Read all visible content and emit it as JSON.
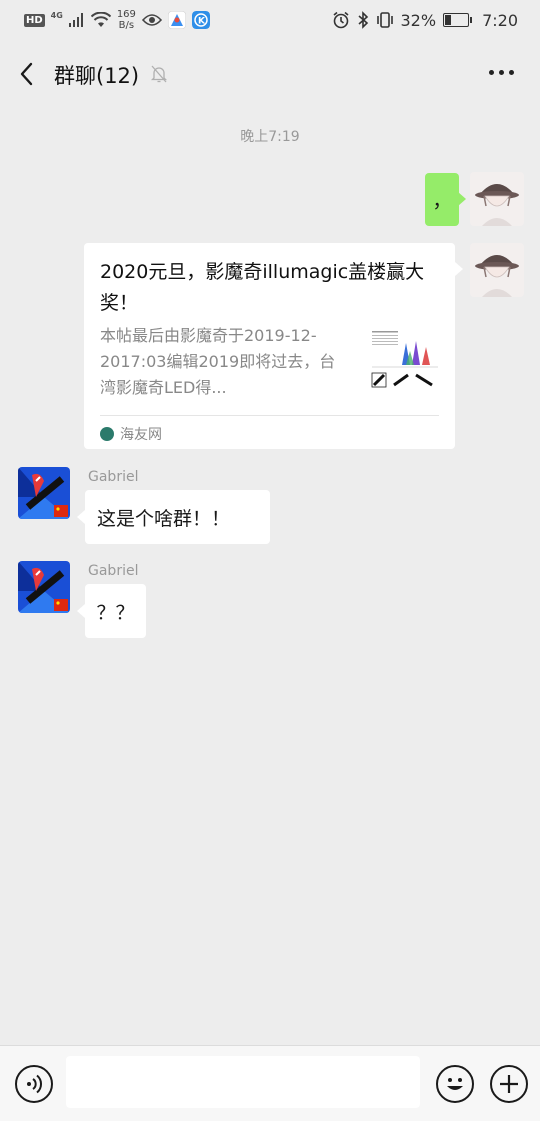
{
  "status_bar": {
    "hd": "HD",
    "network": "4G",
    "speed_value": "169",
    "speed_unit": "B/s",
    "battery_percent": "32%",
    "battery_level": 0.32,
    "time": "7:20"
  },
  "header": {
    "title": "群聊(12)",
    "muted": true
  },
  "chat": {
    "timestamp": "晚上7:19",
    "messages": {
      "m1": {
        "side": "right",
        "text": "，"
      },
      "m2": {
        "side": "right",
        "card_title": "2020元旦，影魔奇illumagic盖楼赢大奖！",
        "card_desc": "本帖最后由影魔奇于2019-12-2017:03编辑2019即将过去，台湾影魔奇LED得...",
        "card_source": "海友网"
      },
      "m3": {
        "side": "left",
        "sender": "Gabriel",
        "text": "这是个啥群！！"
      },
      "m4": {
        "side": "left",
        "sender": "Gabriel",
        "text": "？？"
      }
    }
  },
  "colors": {
    "background": "#ededed",
    "my_bubble": "#95ec69",
    "other_bubble": "#ffffff"
  }
}
